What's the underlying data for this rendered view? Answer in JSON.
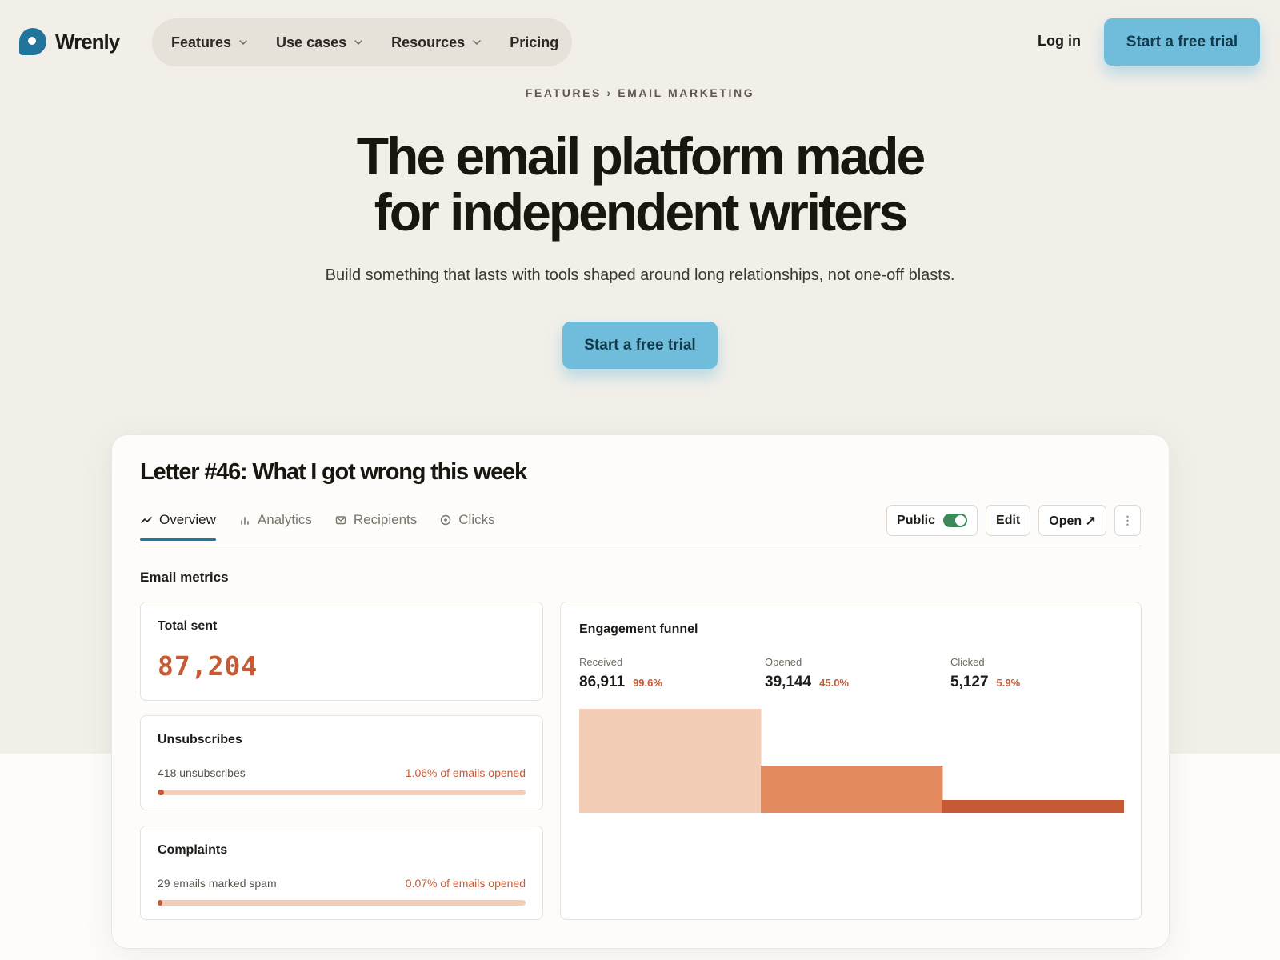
{
  "brand": {
    "name": "Wrenly"
  },
  "nav": {
    "items": [
      {
        "label": "Features",
        "has_menu": true
      },
      {
        "label": "Use cases",
        "has_menu": true
      },
      {
        "label": "Resources",
        "has_menu": true
      },
      {
        "label": "Pricing",
        "has_menu": false
      }
    ],
    "login_label": "Log in",
    "cta_label": "Start a free trial"
  },
  "hero": {
    "breadcrumb": "FEATURES › EMAIL MARKETING",
    "headline_line1": "The email platform made",
    "headline_line2": "for independent writers",
    "subhead": "Build something that lasts with tools shaped around long relationships, not one-off blasts.",
    "cta_label": "Start a free trial"
  },
  "dashboard": {
    "title": "Letter #46: What I got wrong this week",
    "tabs": [
      {
        "label": "Overview",
        "icon": "trend-icon",
        "active": true
      },
      {
        "label": "Analytics",
        "icon": "bar-chart-icon",
        "active": false
      },
      {
        "label": "Recipients",
        "icon": "mail-icon",
        "active": false
      },
      {
        "label": "Clicks",
        "icon": "target-icon",
        "active": false
      }
    ],
    "actions": {
      "public_label": "Public",
      "public_on": true,
      "edit_label": "Edit",
      "open_label": "Open ↗",
      "more_label": "⋮"
    },
    "metrics_label": "Email metrics",
    "total_sent": {
      "title": "Total sent",
      "value": "87,204"
    },
    "unsubscribes": {
      "title": "Unsubscribes",
      "detail": "418 unsubscribes",
      "rate_label": "1.06% of emails opened",
      "rate": 0.0106
    },
    "complaints": {
      "title": "Complaints",
      "detail": "29 emails marked spam",
      "rate_label": "0.07% of emails opened",
      "rate": 0.0007
    }
  },
  "colors": {
    "accent": "#6fbcdb",
    "brand": "#21749a",
    "metric": "#c55a34",
    "toggle_on": "#3c8a5a"
  },
  "chart_data": {
    "type": "bar",
    "title": "Engagement funnel",
    "categories": [
      "Received",
      "Opened",
      "Clicked"
    ],
    "values": [
      86911,
      39144,
      5127
    ],
    "value_labels": [
      "86,911",
      "39,144",
      "5,127"
    ],
    "percent_labels": [
      "99.6%",
      "45.0%",
      "5.9%"
    ],
    "colors": [
      "#f4cdb6",
      "#e38b5f",
      "#c55a34"
    ],
    "xlabel": "",
    "ylabel": ""
  }
}
